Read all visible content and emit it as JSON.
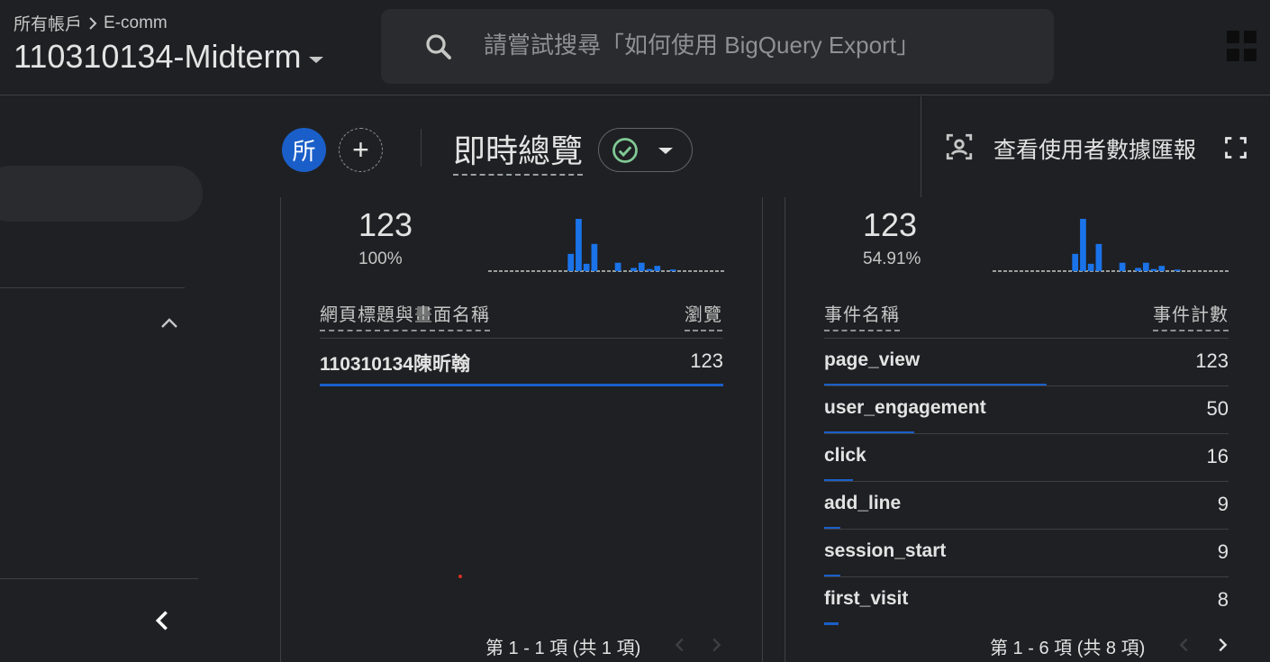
{
  "header": {
    "breadcrumb_account": "所有帳戶",
    "breadcrumb_property": "E-comm",
    "property_title": "110310134-Midterm",
    "search_placeholder": "請嘗試搜尋「如何使用 BigQuery Export」"
  },
  "subheader": {
    "avatar_letter": "所",
    "add_label": "+",
    "page_title": "即時總覽",
    "user_report_label": "查看使用者數據匯報"
  },
  "card_pages": {
    "total": "123",
    "percent": "100%",
    "col_name": "網頁標題與畫面名稱",
    "col_value": "瀏覽",
    "rows": [
      {
        "name": "110310134陳昕翰",
        "value": "123",
        "share": 1.0
      }
    ],
    "pager": "第 1 - 1 項 (共 1 項)"
  },
  "card_events": {
    "total": "123",
    "percent": "54.91%",
    "col_name": "事件名稱",
    "col_value": "事件計數",
    "rows": [
      {
        "name": "page_view",
        "value": "123",
        "share": 1.0
      },
      {
        "name": "user_engagement",
        "value": "50",
        "share": 0.4065
      },
      {
        "name": "click",
        "value": "16",
        "share": 0.13
      },
      {
        "name": "add_line",
        "value": "9",
        "share": 0.073
      },
      {
        "name": "session_start",
        "value": "9",
        "share": 0.073
      },
      {
        "name": "first_visit",
        "value": "8",
        "share": 0.065
      }
    ],
    "pager": "第 1 - 6 項 (共 8 項)"
  },
  "sparkline": {
    "bars": [
      0,
      0,
      0,
      0,
      0,
      0,
      0,
      0,
      0,
      0,
      0,
      0,
      0,
      0,
      0,
      0,
      0,
      0,
      0,
      0,
      0,
      0,
      0,
      0,
      0,
      0,
      0,
      0,
      0,
      0
    ],
    "series_pages": [
      0,
      0,
      0,
      0,
      0,
      0,
      0,
      0,
      0,
      0,
      0.33,
      1.0,
      0.14,
      0.52,
      0,
      0,
      0.16,
      0,
      0.06,
      0.16,
      0.04,
      0.1,
      0,
      0.03,
      0,
      0,
      0,
      0,
      0,
      0
    ],
    "accent": "#1a73e8"
  },
  "colors": {
    "background": "#1f2023",
    "accent": "#1a5fc9",
    "check": "#81c995"
  }
}
